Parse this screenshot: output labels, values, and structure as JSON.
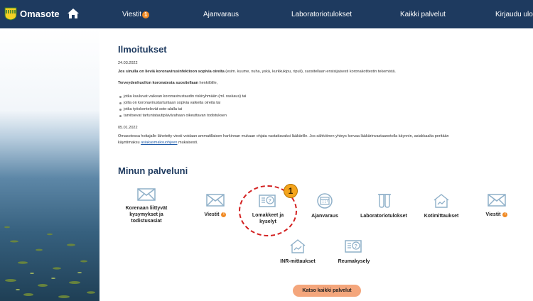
{
  "app": {
    "name": "Omasote"
  },
  "nav": {
    "messages_label": "Viestit",
    "messages_badge": "1",
    "appointments_label": "Ajanvaraus",
    "lab_label": "Laboratoriotulokset",
    "all_services_label": "Kaikki palvelut",
    "logout_label": "Kirjaudu ulos"
  },
  "announcements": {
    "title": "Ilmoitukset",
    "items": [
      {
        "date": "24.03.2022",
        "lead_bold": "Jos sinulla on lieviä koronavirusinfektioon sopivia oireita",
        "lead_rest": " (esim. kuume, nuha, yskä, kurkkukipu, ripuli), suositellaan ensisijaisesti koronakotitestin tekemistä.",
        "sub_bold": "Terveydenhuollon koronatesta suositellaan",
        "sub_rest": " henkilöille,",
        "bullets": [
          "jotka kuuluvat vaikean koronavirustaudin riskiryhmään (ml. raskaus) tai",
          "joilla on koronavirustartuntaan sopivia vaikeita oireita tai",
          "jotka työskentelevät sote-alalla tai",
          "tarvitsevat tartuntatautipäivärahaan oikeuttavan todistuksen"
        ]
      },
      {
        "date": "05.01.2022",
        "text_1": "Omasotessa hoitajalle lähetetty viesti voidaan ammatillaisen harkinnan mukaan ohjata vastattavaksi lääkärille. Jos sähköinen yhteys korvaa lääkärinvastaanotolla käynnin, asiakkaalta peritään",
        "text_2_pre": "käyntimaksu ",
        "text_2_link": "asiakasmaksuohjeen",
        "text_2_post": " mukaisesti."
      }
    ]
  },
  "services": {
    "title": "Minun palveluni",
    "tiles": [
      {
        "label_lines": [
          "Korenaan liittyvät",
          "kysymykset ja",
          "todistusasiat"
        ],
        "icon": "envelope-icon"
      },
      {
        "label": "Viestit",
        "badge": "!",
        "icon": "envelope-icon"
      },
      {
        "label_lines": [
          "Lomakkeet ja",
          "kyselyt"
        ],
        "icon": "form-question-icon"
      },
      {
        "label": "Ajanvaraus",
        "icon": "calendar-icon"
      },
      {
        "label": "Laboratoriotulokset",
        "icon": "test-tubes-icon"
      },
      {
        "label": "Kotimittaukset",
        "icon": "home-chart-icon"
      },
      {
        "label": "Viestit",
        "badge": "!",
        "icon": "envelope-icon"
      },
      {
        "label": "INR-mittaukset",
        "icon": "home-chart-icon"
      },
      {
        "label": "Reumakysely",
        "icon": "form-question-icon"
      }
    ],
    "all_button_label": "Katso kaikki palvelut"
  },
  "annotation": {
    "number": "1"
  },
  "colors": {
    "navbar": "#1e3a5f",
    "accent": "#f08a24",
    "icon": "#8fb0c9",
    "button": "#f4a67c",
    "callout": "#d32020"
  }
}
